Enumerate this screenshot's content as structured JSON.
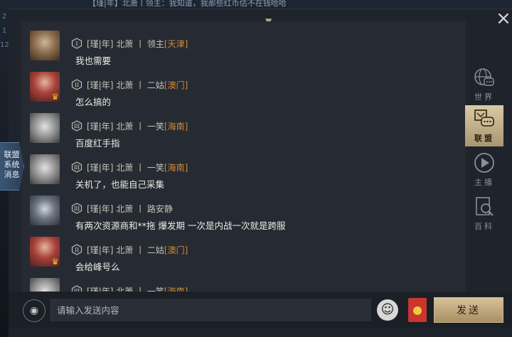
{
  "behind": {
    "top_strip": "【瑾|年】北萧丨领主：我知道，我那些红币估不在钱哈哈",
    "left_digits": [
      "2",
      "1",
      "12"
    ]
  },
  "side_tab": {
    "label_lines": [
      "联盟",
      "系统",
      "消息"
    ]
  },
  "close_icon": "×",
  "messages": [
    {
      "rank": "I",
      "guild": "[瑾|年]",
      "name": "北萧",
      "title": "领主",
      "region": "[天津]",
      "text": "我也需要",
      "avatar": "dwarf",
      "crown": false
    },
    {
      "rank": "II",
      "guild": "[瑾|年]",
      "name": "北萧",
      "title": "二姑",
      "region": "[澳门]",
      "text": "怎么搞的",
      "avatar": "woman",
      "crown": true
    },
    {
      "rank": "III",
      "guild": "[瑾|年]",
      "name": "北萧",
      "title": "一笑",
      "region": "[海南]",
      "text": "百度红手指",
      "avatar": "wolf",
      "crown": false
    },
    {
      "rank": "III",
      "guild": "[瑾|年]",
      "name": "北萧",
      "title": "一笑",
      "region": "[海南]",
      "text": "关机了，也能自己采集",
      "avatar": "wolf",
      "crown": false
    },
    {
      "rank": "III",
      "guild": "[瑾|年]",
      "name": "北萧",
      "title": "路安静",
      "region": "",
      "text": "有两次资源商和**拖 爆发期 一次是内战一次就是跨服",
      "avatar": "fire",
      "crown": false
    },
    {
      "rank": "II",
      "guild": "[瑾|年]",
      "name": "北萧",
      "title": "二姑",
      "region": "[澳门]",
      "text": "会给峰号么",
      "avatar": "woman",
      "crown": true
    },
    {
      "rank": "III",
      "guild": "[瑾|年]",
      "name": "北萧",
      "title": "一笑",
      "region": "[海南]",
      "text": "",
      "avatar": "wolf",
      "crown": false
    }
  ],
  "rail": [
    {
      "label": "世界",
      "icon": "world-icon",
      "active": false
    },
    {
      "label": "联盟",
      "icon": "alliance-icon",
      "active": true
    },
    {
      "label": "主播",
      "icon": "play-icon",
      "active": false
    },
    {
      "label": "百科",
      "icon": "encyclopedia-icon",
      "active": false
    }
  ],
  "input": {
    "placeholder": "请输入发送内容"
  },
  "send_label": "发送",
  "colors": {
    "region": "#d28a2c",
    "accent_gold": "#c9b288",
    "panel": "#1f242c"
  }
}
